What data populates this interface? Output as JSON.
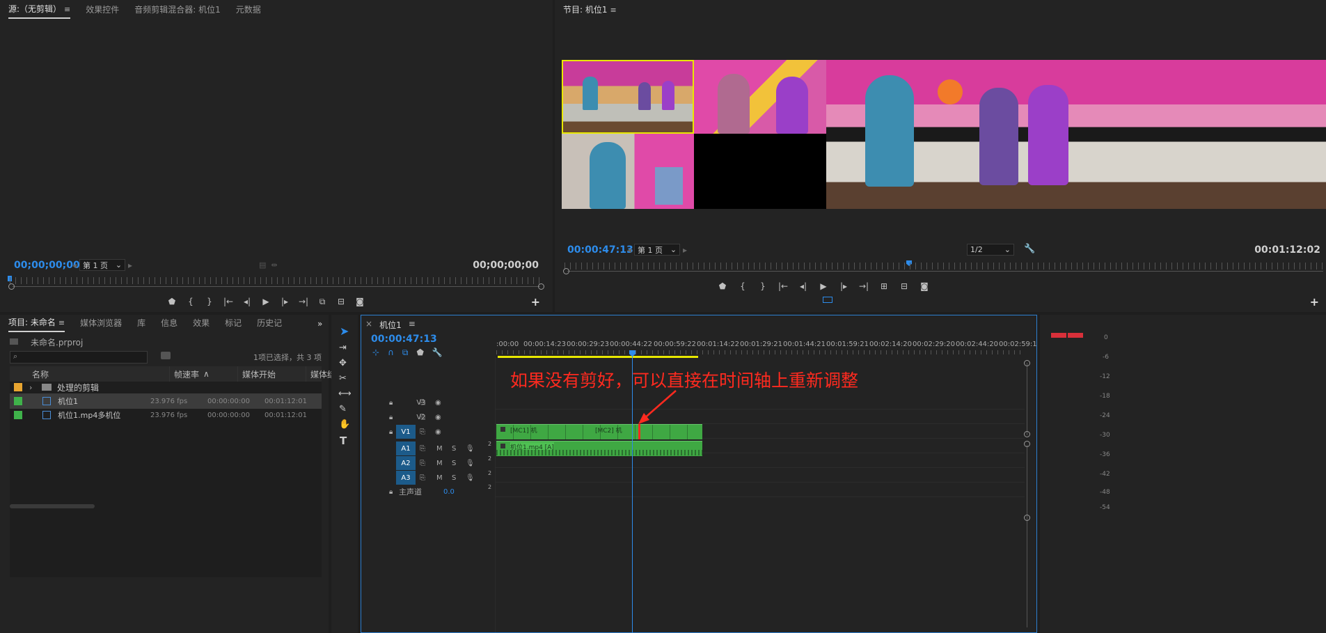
{
  "source": {
    "tabs": [
      "源:（无剪辑）",
      "效果控件",
      "音频剪辑混合器: 机位1",
      "元数据"
    ],
    "timecode_left": "00;00;00;00",
    "page_select": "第 1 页",
    "timecode_right": "00;00;00;00"
  },
  "program": {
    "title": "节目: 机位1",
    "timecode_left": "00:00:47:13",
    "page_select": "第 1 页",
    "zoom_select": "1/2",
    "timecode_right": "00:01:12:02"
  },
  "project": {
    "tabs": [
      "项目: 未命名",
      "媒体浏览器",
      "库",
      "信息",
      "效果",
      "标记",
      "历史记"
    ],
    "file": "未命名.prproj",
    "selection_text": "1项已选择，共 3 项",
    "columns": [
      "名称",
      "帧速率",
      "媒体开始",
      "媒体结束",
      "媒"
    ],
    "rows": [
      {
        "name": "处理的剪辑",
        "fps": "",
        "start": "",
        "end": "",
        "color": "#e8a530",
        "type": "folder"
      },
      {
        "name": "机位1",
        "fps": "23.976 fps",
        "start": "00:00:00:00",
        "end": "00:01:12:01",
        "color": "#3fb24a",
        "type": "seq"
      },
      {
        "name": "机位1.mp4多机位",
        "fps": "23.976 fps",
        "start": "00:00:00:00",
        "end": "00:01:12:01",
        "color": "#3fb24a",
        "type": "seq"
      }
    ]
  },
  "timeline": {
    "tab": "机位1",
    "timecode": "00:00:47:13",
    "ruler": [
      ":00:00",
      "00:00:14:23",
      "00:00:29:23",
      "00:00:44:22",
      "00:00:59:22",
      "00:01:14:22",
      "00:01:29:21",
      "00:01:44:21",
      "00:01:59:21",
      "00:02:14:20",
      "00:02:29:20",
      "00:02:44:20",
      "00:02:59:1"
    ],
    "tracks": [
      {
        "name": "V3",
        "label": "V3",
        "on": false
      },
      {
        "name": "V2",
        "label": "V2",
        "on": false
      },
      {
        "name": "V1",
        "label": "V1",
        "on": true
      }
    ],
    "audio": [
      {
        "name": "A1",
        "on": true,
        "num": "2"
      },
      {
        "name": "A2",
        "on": true,
        "num": "2"
      },
      {
        "name": "A3",
        "on": true,
        "num": "2"
      }
    ],
    "master": "主声道",
    "master_val": "0.0",
    "master_num": "2",
    "clips": {
      "v1_a": "[MC1] 机",
      "v1_b": "[MC2] 机",
      "a1": "机位1.mp4 [A]"
    },
    "annotation": "如果没有剪好，可以直接在时间轴上重新调整"
  },
  "meters": [
    "0",
    "-6",
    "-12",
    "-18",
    "-24",
    "-30",
    "-36",
    "-42",
    "-48",
    "-54"
  ],
  "colors": {
    "accent": "#2d8ceb",
    "clip": "#3fa843",
    "annotation": "#ff2a1f",
    "selected": "#e8e800"
  }
}
